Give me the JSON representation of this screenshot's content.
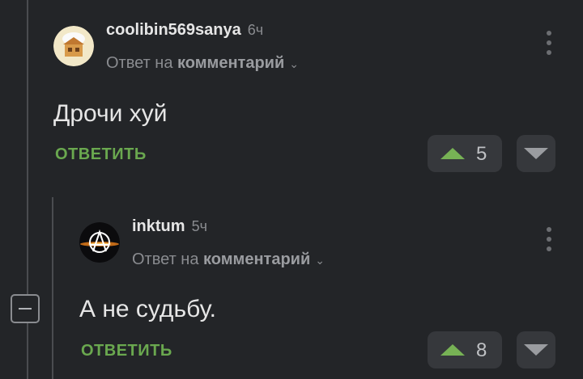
{
  "comments": [
    {
      "username": "coolibin569sanya",
      "time": "6ч",
      "reply_prefix": "Ответ на",
      "reply_target": "комментарий",
      "text": "Дрочи хуй",
      "reply_label": "ОТВЕТИТЬ",
      "votes": "5"
    },
    {
      "username": "inktum",
      "time": "5ч",
      "reply_prefix": "Ответ на",
      "reply_target": "комментарий",
      "text": "А не судьбу.",
      "reply_label": "ОТВЕТИТЬ",
      "votes": "8"
    }
  ],
  "colors": {
    "background": "#232528",
    "accent_green": "#6aa84f",
    "button_bg": "#36383c"
  },
  "icons": {
    "upvote": "triangle-up-icon",
    "downvote": "triangle-down-icon",
    "more": "kebab-menu-icon",
    "collapse": "minus-icon",
    "chevron": "chevron-down-icon"
  }
}
